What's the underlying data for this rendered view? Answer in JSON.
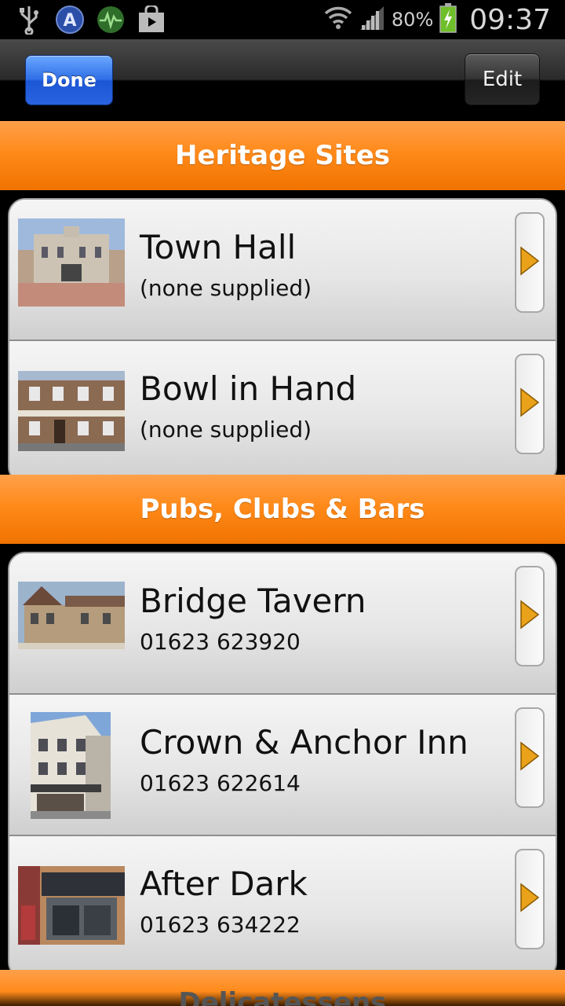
{
  "status_bar": {
    "icons": [
      "usb-icon",
      "a-badge-icon",
      "activity-icon",
      "shopping-bag-icon"
    ],
    "wifi": "wifi-icon",
    "signal": "signal-icon",
    "battery_percent": "80%",
    "battery_icon": "battery-charging-icon",
    "time": "09:37"
  },
  "actionbar": {
    "done_label": "Done",
    "edit_label": "Edit"
  },
  "sections": [
    {
      "title": "Heritage Sites",
      "items": [
        {
          "title": "Town Hall",
          "subtitle": "(none supplied)",
          "thumb": "town-hall-photo"
        },
        {
          "title": "Bowl in Hand",
          "subtitle": "(none supplied)",
          "thumb": "bowl-in-hand-photo"
        }
      ]
    },
    {
      "title": "Pubs, Clubs & Bars",
      "items": [
        {
          "title": "Bridge Tavern",
          "subtitle": "01623 623920",
          "thumb": "bridge-tavern-photo"
        },
        {
          "title": "Crown & Anchor Inn",
          "subtitle": "01623 622614",
          "thumb": "crown-anchor-photo"
        },
        {
          "title": "After Dark",
          "subtitle": "01623 634222",
          "thumb": "after-dark-photo"
        }
      ]
    }
  ],
  "bottom_section_title": "Delicatessens",
  "colors": {
    "accent_orange": "#ff8a1a",
    "done_blue": "#2f6fe6",
    "arrow_orange": "#e9a21a"
  }
}
